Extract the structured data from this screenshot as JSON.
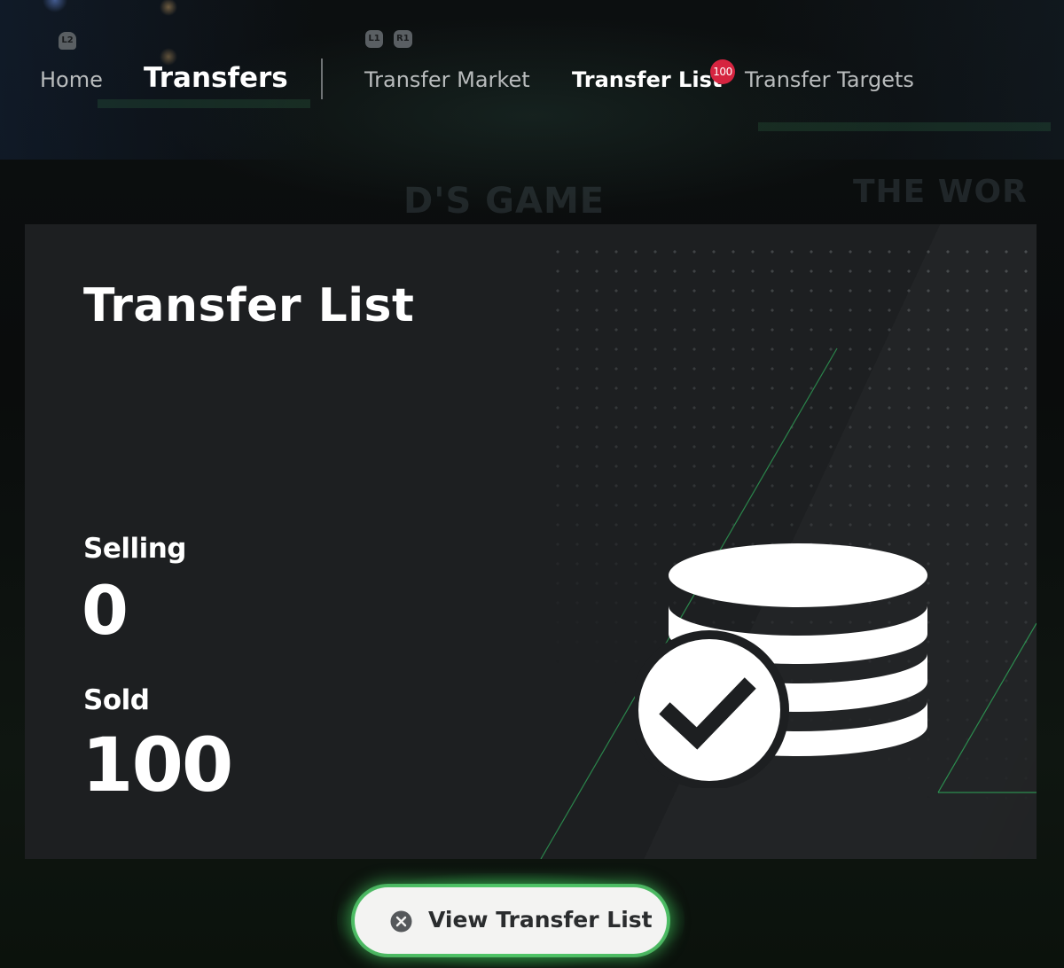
{
  "nav": {
    "hints": {
      "left_trigger": "L2",
      "left_bumper": "L1",
      "right_bumper": "R1"
    },
    "home": "Home",
    "section": "Transfers",
    "tabs": [
      {
        "label": "Transfer Market"
      },
      {
        "label": "Transfer List",
        "badge": "100",
        "selected": true
      },
      {
        "label": "Transfer Targets"
      }
    ]
  },
  "background": {
    "banner_text_1": "D'S GAME",
    "banner_text_2": "THE WOR"
  },
  "card": {
    "title": "Transfer List",
    "selling": {
      "label": "Selling",
      "value": "0"
    },
    "sold": {
      "label": "Sold",
      "value": "100"
    },
    "icon": "coin-stack-check-icon"
  },
  "action": {
    "icon": "x-button-icon",
    "label": "View Transfer List"
  },
  "colors": {
    "badge": "#d62440",
    "accent_green": "#3be07a",
    "card": "#1d1f21"
  }
}
